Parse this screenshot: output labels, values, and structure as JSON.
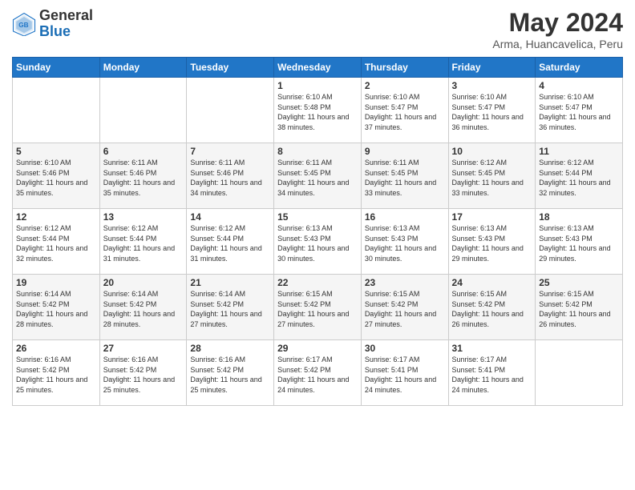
{
  "header": {
    "logo_general": "General",
    "logo_blue": "Blue",
    "month_title": "May 2024",
    "location": "Arma, Huancavelica, Peru"
  },
  "weekdays": [
    "Sunday",
    "Monday",
    "Tuesday",
    "Wednesday",
    "Thursday",
    "Friday",
    "Saturday"
  ],
  "weeks": [
    [
      {
        "day": "",
        "sunrise": "",
        "sunset": "",
        "daylight": ""
      },
      {
        "day": "",
        "sunrise": "",
        "sunset": "",
        "daylight": ""
      },
      {
        "day": "",
        "sunrise": "",
        "sunset": "",
        "daylight": ""
      },
      {
        "day": "1",
        "sunrise": "Sunrise: 6:10 AM",
        "sunset": "Sunset: 5:48 PM",
        "daylight": "Daylight: 11 hours and 38 minutes."
      },
      {
        "day": "2",
        "sunrise": "Sunrise: 6:10 AM",
        "sunset": "Sunset: 5:47 PM",
        "daylight": "Daylight: 11 hours and 37 minutes."
      },
      {
        "day": "3",
        "sunrise": "Sunrise: 6:10 AM",
        "sunset": "Sunset: 5:47 PM",
        "daylight": "Daylight: 11 hours and 36 minutes."
      },
      {
        "day": "4",
        "sunrise": "Sunrise: 6:10 AM",
        "sunset": "Sunset: 5:47 PM",
        "daylight": "Daylight: 11 hours and 36 minutes."
      }
    ],
    [
      {
        "day": "5",
        "sunrise": "Sunrise: 6:10 AM",
        "sunset": "Sunset: 5:46 PM",
        "daylight": "Daylight: 11 hours and 35 minutes."
      },
      {
        "day": "6",
        "sunrise": "Sunrise: 6:11 AM",
        "sunset": "Sunset: 5:46 PM",
        "daylight": "Daylight: 11 hours and 35 minutes."
      },
      {
        "day": "7",
        "sunrise": "Sunrise: 6:11 AM",
        "sunset": "Sunset: 5:46 PM",
        "daylight": "Daylight: 11 hours and 34 minutes."
      },
      {
        "day": "8",
        "sunrise": "Sunrise: 6:11 AM",
        "sunset": "Sunset: 5:45 PM",
        "daylight": "Daylight: 11 hours and 34 minutes."
      },
      {
        "day": "9",
        "sunrise": "Sunrise: 6:11 AM",
        "sunset": "Sunset: 5:45 PM",
        "daylight": "Daylight: 11 hours and 33 minutes."
      },
      {
        "day": "10",
        "sunrise": "Sunrise: 6:12 AM",
        "sunset": "Sunset: 5:45 PM",
        "daylight": "Daylight: 11 hours and 33 minutes."
      },
      {
        "day": "11",
        "sunrise": "Sunrise: 6:12 AM",
        "sunset": "Sunset: 5:44 PM",
        "daylight": "Daylight: 11 hours and 32 minutes."
      }
    ],
    [
      {
        "day": "12",
        "sunrise": "Sunrise: 6:12 AM",
        "sunset": "Sunset: 5:44 PM",
        "daylight": "Daylight: 11 hours and 32 minutes."
      },
      {
        "day": "13",
        "sunrise": "Sunrise: 6:12 AM",
        "sunset": "Sunset: 5:44 PM",
        "daylight": "Daylight: 11 hours and 31 minutes."
      },
      {
        "day": "14",
        "sunrise": "Sunrise: 6:12 AM",
        "sunset": "Sunset: 5:44 PM",
        "daylight": "Daylight: 11 hours and 31 minutes."
      },
      {
        "day": "15",
        "sunrise": "Sunrise: 6:13 AM",
        "sunset": "Sunset: 5:43 PM",
        "daylight": "Daylight: 11 hours and 30 minutes."
      },
      {
        "day": "16",
        "sunrise": "Sunrise: 6:13 AM",
        "sunset": "Sunset: 5:43 PM",
        "daylight": "Daylight: 11 hours and 30 minutes."
      },
      {
        "day": "17",
        "sunrise": "Sunrise: 6:13 AM",
        "sunset": "Sunset: 5:43 PM",
        "daylight": "Daylight: 11 hours and 29 minutes."
      },
      {
        "day": "18",
        "sunrise": "Sunrise: 6:13 AM",
        "sunset": "Sunset: 5:43 PM",
        "daylight": "Daylight: 11 hours and 29 minutes."
      }
    ],
    [
      {
        "day": "19",
        "sunrise": "Sunrise: 6:14 AM",
        "sunset": "Sunset: 5:42 PM",
        "daylight": "Daylight: 11 hours and 28 minutes."
      },
      {
        "day": "20",
        "sunrise": "Sunrise: 6:14 AM",
        "sunset": "Sunset: 5:42 PM",
        "daylight": "Daylight: 11 hours and 28 minutes."
      },
      {
        "day": "21",
        "sunrise": "Sunrise: 6:14 AM",
        "sunset": "Sunset: 5:42 PM",
        "daylight": "Daylight: 11 hours and 27 minutes."
      },
      {
        "day": "22",
        "sunrise": "Sunrise: 6:15 AM",
        "sunset": "Sunset: 5:42 PM",
        "daylight": "Daylight: 11 hours and 27 minutes."
      },
      {
        "day": "23",
        "sunrise": "Sunrise: 6:15 AM",
        "sunset": "Sunset: 5:42 PM",
        "daylight": "Daylight: 11 hours and 27 minutes."
      },
      {
        "day": "24",
        "sunrise": "Sunrise: 6:15 AM",
        "sunset": "Sunset: 5:42 PM",
        "daylight": "Daylight: 11 hours and 26 minutes."
      },
      {
        "day": "25",
        "sunrise": "Sunrise: 6:15 AM",
        "sunset": "Sunset: 5:42 PM",
        "daylight": "Daylight: 11 hours and 26 minutes."
      }
    ],
    [
      {
        "day": "26",
        "sunrise": "Sunrise: 6:16 AM",
        "sunset": "Sunset: 5:42 PM",
        "daylight": "Daylight: 11 hours and 25 minutes."
      },
      {
        "day": "27",
        "sunrise": "Sunrise: 6:16 AM",
        "sunset": "Sunset: 5:42 PM",
        "daylight": "Daylight: 11 hours and 25 minutes."
      },
      {
        "day": "28",
        "sunrise": "Sunrise: 6:16 AM",
        "sunset": "Sunset: 5:42 PM",
        "daylight": "Daylight: 11 hours and 25 minutes."
      },
      {
        "day": "29",
        "sunrise": "Sunrise: 6:17 AM",
        "sunset": "Sunset: 5:42 PM",
        "daylight": "Daylight: 11 hours and 24 minutes."
      },
      {
        "day": "30",
        "sunrise": "Sunrise: 6:17 AM",
        "sunset": "Sunset: 5:41 PM",
        "daylight": "Daylight: 11 hours and 24 minutes."
      },
      {
        "day": "31",
        "sunrise": "Sunrise: 6:17 AM",
        "sunset": "Sunset: 5:41 PM",
        "daylight": "Daylight: 11 hours and 24 minutes."
      },
      {
        "day": "",
        "sunrise": "",
        "sunset": "",
        "daylight": ""
      }
    ]
  ]
}
